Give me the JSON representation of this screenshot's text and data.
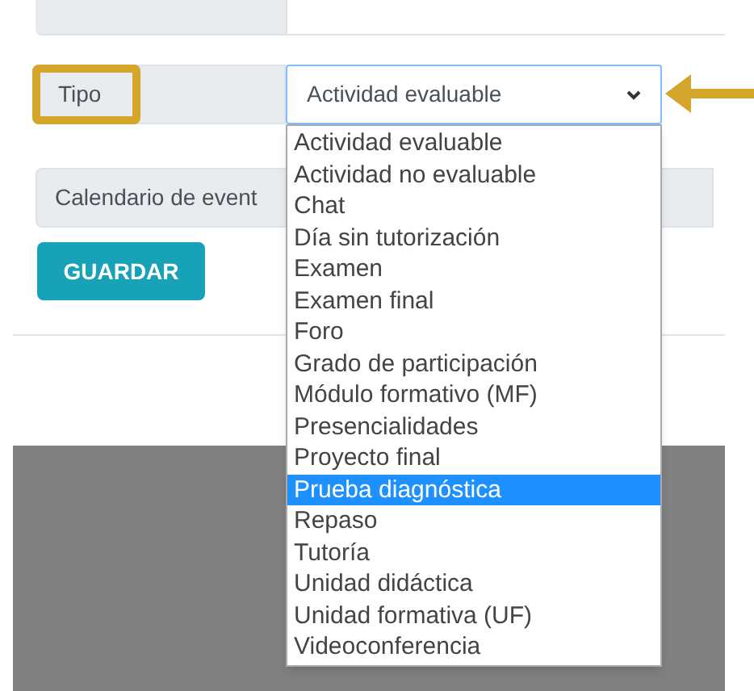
{
  "tipo_field": {
    "label": "Tipo",
    "label_outlined": true,
    "value": "Actividad evaluable",
    "expanded": true
  },
  "options": [
    {
      "label": "Actividad evaluable",
      "highlighted": false
    },
    {
      "label": "Actividad no evaluable",
      "highlighted": false
    },
    {
      "label": "Chat",
      "highlighted": false
    },
    {
      "label": "Día sin tutorización",
      "highlighted": false
    },
    {
      "label": "Examen",
      "highlighted": false
    },
    {
      "label": "Examen final",
      "highlighted": false
    },
    {
      "label": "Foro",
      "highlighted": false
    },
    {
      "label": "Grado de participación",
      "highlighted": false
    },
    {
      "label": "Módulo formativo (MF)",
      "highlighted": false
    },
    {
      "label": "Presencialidades",
      "highlighted": false
    },
    {
      "label": "Proyecto final",
      "highlighted": false
    },
    {
      "label": "Prueba diagnóstica",
      "highlighted": true
    },
    {
      "label": "Repaso",
      "highlighted": false
    },
    {
      "label": "Tutoría",
      "highlighted": false
    },
    {
      "label": "Unidad didáctica",
      "highlighted": false
    },
    {
      "label": "Unidad formativa (UF)",
      "highlighted": false
    },
    {
      "label": "Videoconferencia",
      "highlighted": false
    }
  ],
  "calendar_field": {
    "label": "Calendario de event"
  },
  "save_button": {
    "label": "GUARDAR"
  }
}
